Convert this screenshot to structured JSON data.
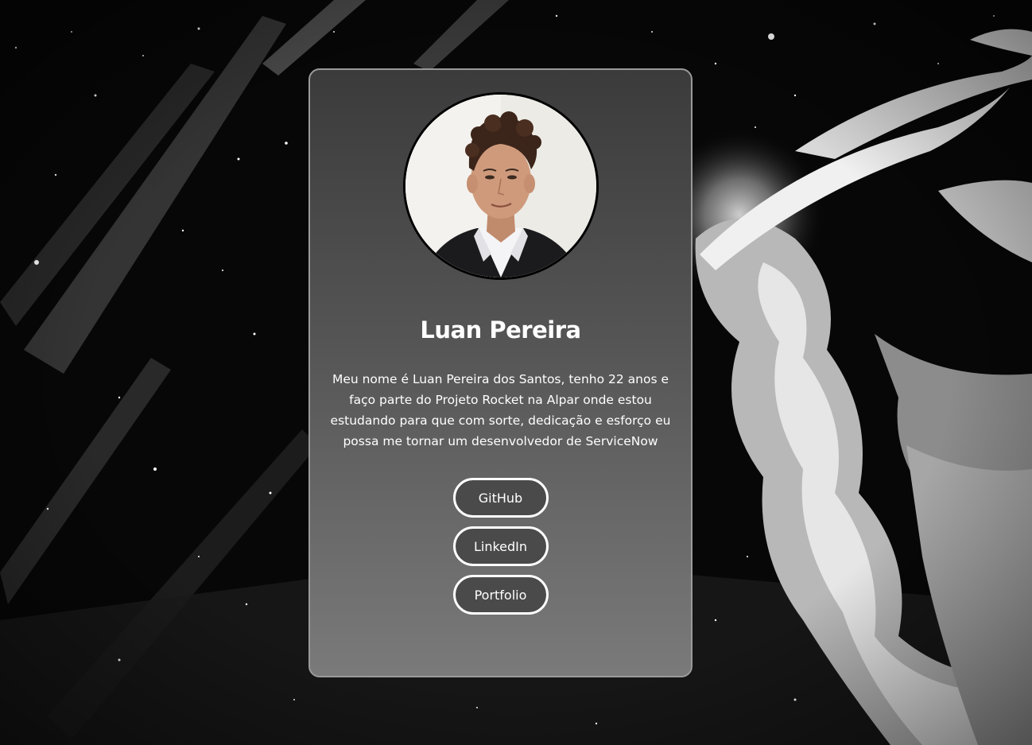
{
  "profile": {
    "name": "Luan Pereira",
    "bio": "Meu nome é Luan Pereira dos Santos, tenho 22 anos e faço parte do Projeto Rocket na Alpar onde estou estudando para que com sorte, dedicação e esforço eu possa me tornar um desenvolvedor de ServiceNow"
  },
  "links": [
    {
      "label": "GitHub"
    },
    {
      "label": "LinkedIn"
    },
    {
      "label": "Portfolio"
    }
  ],
  "theme": {
    "background": "#060606",
    "card_top": "#3b3b3b",
    "card_bottom": "#7a7a7a",
    "button_fill": "#4a4a4a",
    "text": "#ffffff"
  }
}
